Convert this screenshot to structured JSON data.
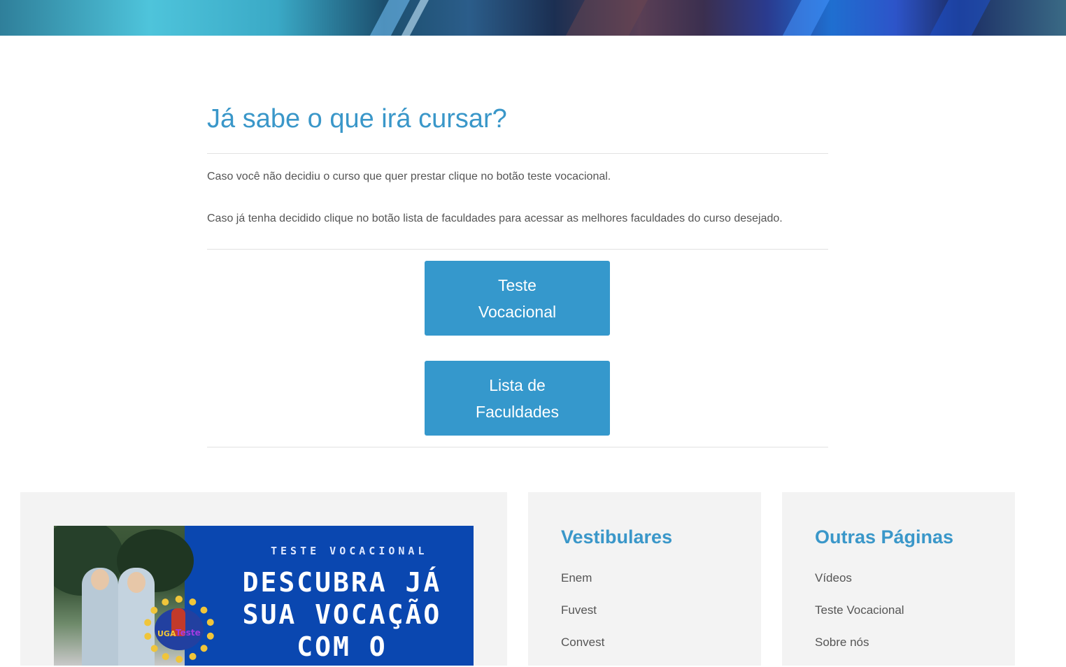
{
  "main": {
    "title": "Já sabe o que irá cursar?",
    "paragraphs": [
      "Caso você não decidiu o curso que quer prestar clique no botão teste vocacional.",
      "Caso já tenha decidido clique no botão lista de faculdades para acessar as melhores faculdades do curso desejado."
    ],
    "buttons": [
      {
        "line1": "Teste",
        "line2": "Vocacional"
      },
      {
        "line1": "Lista de",
        "line2": "Faculdades"
      }
    ]
  },
  "footer": {
    "banner": {
      "kicker": "TESTE VOCACIONAL",
      "headline": [
        "DESCUBRA JÁ",
        "SUA VOCAÇÃO",
        "COM O"
      ],
      "logo_text_left": "UGA",
      "logo_text_right": "Teste"
    },
    "widgets": [
      {
        "title": "Vestibulares",
        "items": [
          "Enem",
          "Fuvest",
          "Convest"
        ]
      },
      {
        "title": "Outras Páginas",
        "items": [
          "Vídeos",
          "Teste Vocacional",
          "Sobre nós"
        ]
      }
    ]
  },
  "colors": {
    "accent": "#3a97c9",
    "button": "#3598cc",
    "footer_bg": "#f3f3f3",
    "banner_bg": "#0a47b0"
  }
}
